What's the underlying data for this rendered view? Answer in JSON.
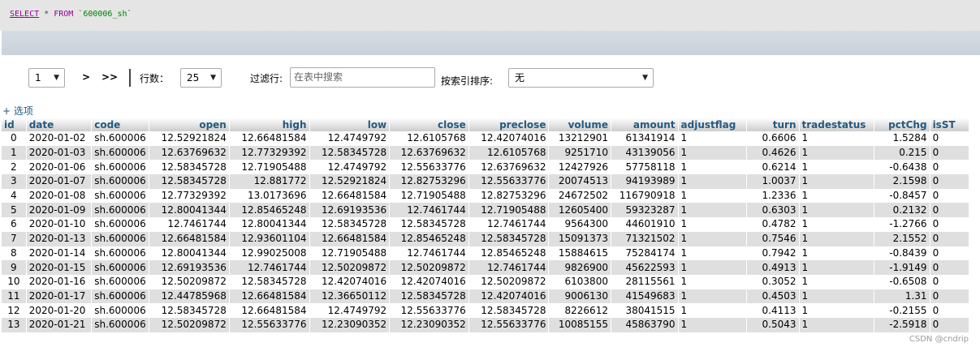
{
  "sql": {
    "select_kw": "SELECT",
    "star": " * ",
    "from_kw": "FROM",
    "table": " `600006_sh`"
  },
  "nav": {
    "page_value": "1",
    "next_label": ">",
    "last_label": ">>",
    "rows_label": "行数：",
    "rows_value": "25",
    "filter_label": "过滤行:",
    "filter_placeholder": "在表中搜索",
    "sort_label": "按索引排序:",
    "sort_value": "无",
    "arrow_glyph": "▼"
  },
  "options_label": "+ 选项",
  "table": {
    "columns": [
      "id",
      "date",
      "code",
      "open",
      "high",
      "low",
      "close",
      "preclose",
      "volume",
      "amount",
      "adjustflag",
      "turn",
      "tradestatus",
      "pctChg",
      "isST"
    ],
    "rows": [
      [
        "0",
        "2020-01-02",
        "sh.600006",
        "12.52921824",
        "12.66481584",
        "12.4749792",
        "12.6105768",
        "12.42074016",
        "13212901",
        "61341914",
        "1",
        "0.6606",
        "1",
        "1.5284",
        "0"
      ],
      [
        "1",
        "2020-01-03",
        "sh.600006",
        "12.63769632",
        "12.77329392",
        "12.58345728",
        "12.63769632",
        "12.6105768",
        "9251710",
        "43139056",
        "1",
        "0.4626",
        "1",
        "0.215",
        "0"
      ],
      [
        "2",
        "2020-01-06",
        "sh.600006",
        "12.58345728",
        "12.71905488",
        "12.4749792",
        "12.55633776",
        "12.63769632",
        "12427926",
        "57758118",
        "1",
        "0.6214",
        "1",
        "-0.6438",
        "0"
      ],
      [
        "3",
        "2020-01-07",
        "sh.600006",
        "12.58345728",
        "12.881772",
        "12.52921824",
        "12.82753296",
        "12.55633776",
        "20074513",
        "94193989",
        "1",
        "1.0037",
        "1",
        "2.1598",
        "0"
      ],
      [
        "4",
        "2020-01-08",
        "sh.600006",
        "12.77329392",
        "13.0173696",
        "12.66481584",
        "12.71905488",
        "12.82753296",
        "24672502",
        "116790918",
        "1",
        "1.2336",
        "1",
        "-0.8457",
        "0"
      ],
      [
        "5",
        "2020-01-09",
        "sh.600006",
        "12.80041344",
        "12.85465248",
        "12.69193536",
        "12.7461744",
        "12.71905488",
        "12605400",
        "59323287",
        "1",
        "0.6303",
        "1",
        "0.2132",
        "0"
      ],
      [
        "6",
        "2020-01-10",
        "sh.600006",
        "12.7461744",
        "12.80041344",
        "12.58345728",
        "12.58345728",
        "12.7461744",
        "9564300",
        "44601910",
        "1",
        "0.4782",
        "1",
        "-1.2766",
        "0"
      ],
      [
        "7",
        "2020-01-13",
        "sh.600006",
        "12.66481584",
        "12.93601104",
        "12.66481584",
        "12.85465248",
        "12.58345728",
        "15091373",
        "71321502",
        "1",
        "0.7546",
        "1",
        "2.1552",
        "0"
      ],
      [
        "8",
        "2020-01-14",
        "sh.600006",
        "12.80041344",
        "12.99025008",
        "12.71905488",
        "12.7461744",
        "12.85465248",
        "15884615",
        "75284174",
        "1",
        "0.7942",
        "1",
        "-0.8439",
        "0"
      ],
      [
        "9",
        "2020-01-15",
        "sh.600006",
        "12.69193536",
        "12.7461744",
        "12.50209872",
        "12.50209872",
        "12.7461744",
        "9826900",
        "45622593",
        "1",
        "0.4913",
        "1",
        "-1.9149",
        "0"
      ],
      [
        "10",
        "2020-01-16",
        "sh.600006",
        "12.50209872",
        "12.58345728",
        "12.42074016",
        "12.42074016",
        "12.50209872",
        "6103800",
        "28115561",
        "1",
        "0.3052",
        "1",
        "-0.6508",
        "0"
      ],
      [
        "11",
        "2020-01-17",
        "sh.600006",
        "12.44785968",
        "12.66481584",
        "12.36650112",
        "12.58345728",
        "12.42074016",
        "9006130",
        "41549683",
        "1",
        "0.4503",
        "1",
        "1.31",
        "0"
      ],
      [
        "12",
        "2020-01-20",
        "sh.600006",
        "12.58345728",
        "12.66481584",
        "12.4749792",
        "12.55633776",
        "12.58345728",
        "8226612",
        "38041515",
        "1",
        "0.4113",
        "1",
        "-0.2155",
        "0"
      ],
      [
        "13",
        "2020-01-21",
        "sh.600006",
        "12.50209872",
        "12.55633776",
        "12.23090352",
        "12.23090352",
        "12.55633776",
        "10085155",
        "45863790",
        "1",
        "0.5043",
        "1",
        "-2.5918",
        "0"
      ]
    ]
  },
  "watermark": "CSDN @cndrip"
}
